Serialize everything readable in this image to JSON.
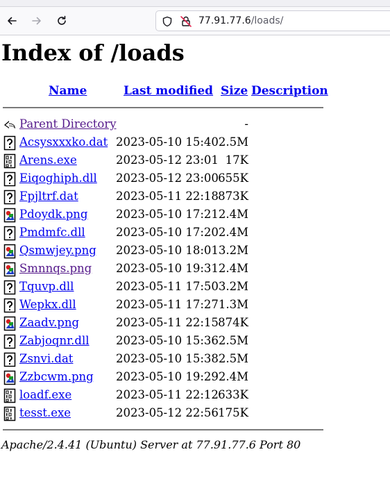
{
  "browser": {
    "url_host": "77.91.77.6",
    "url_path": "/loads/"
  },
  "page": {
    "title": "Index of /loads",
    "columns": {
      "name": "Name",
      "last_modified": "Last modified",
      "size": "Size",
      "description": "Description"
    },
    "parent": {
      "label": "Parent Directory",
      "size": "-"
    },
    "files": [
      {
        "name": "Acsysxxxko.dat",
        "date": "2023-05-10 15:40",
        "size": "2.5M",
        "icon": "unknown-file-icon"
      },
      {
        "name": "Arens.exe",
        "date": "2023-05-12 23:01",
        "size": "17K",
        "icon": "binary-file-icon"
      },
      {
        "name": "Eiqoghiph.dll",
        "date": "2023-05-12 23:00",
        "size": "655K",
        "icon": "unknown-file-icon"
      },
      {
        "name": "Fpjltrf.dat",
        "date": "2023-05-11 22:18",
        "size": "873K",
        "icon": "unknown-file-icon"
      },
      {
        "name": "Pdoydk.png",
        "date": "2023-05-10 17:21",
        "size": "2.4M",
        "icon": "image-file-icon"
      },
      {
        "name": "Pmdmfc.dll",
        "date": "2023-05-10 17:20",
        "size": "2.4M",
        "icon": "unknown-file-icon"
      },
      {
        "name": "Qsmwjey.png",
        "date": "2023-05-10 18:01",
        "size": "3.2M",
        "icon": "image-file-icon"
      },
      {
        "name": "Smnnqs.png",
        "date": "2023-05-10 19:31",
        "size": "2.4M",
        "icon": "image-file-icon"
      },
      {
        "name": "Tquvp.dll",
        "date": "2023-05-11 17:50",
        "size": "3.2M",
        "icon": "unknown-file-icon"
      },
      {
        "name": "Wepkx.dll",
        "date": "2023-05-11 17:27",
        "size": "1.3M",
        "icon": "unknown-file-icon"
      },
      {
        "name": "Zaadv.png",
        "date": "2023-05-11 22:15",
        "size": "874K",
        "icon": "image-file-icon"
      },
      {
        "name": "Zabjoqnr.dll",
        "date": "2023-05-10 15:36",
        "size": "2.5M",
        "icon": "unknown-file-icon"
      },
      {
        "name": "Zsnvi.dat",
        "date": "2023-05-10 15:38",
        "size": "2.5M",
        "icon": "unknown-file-icon"
      },
      {
        "name": "Zzbcwm.png",
        "date": "2023-05-10 19:29",
        "size": "2.4M",
        "icon": "image-file-icon"
      },
      {
        "name": "loadf.exe",
        "date": "2023-05-11 22:12",
        "size": "633K",
        "icon": "binary-file-icon"
      },
      {
        "name": "tesst.exe",
        "date": "2023-05-12 22:56",
        "size": "175K",
        "icon": "binary-file-icon"
      }
    ],
    "footer": "Apache/2.4.41 (Ubuntu) Server at 77.91.77.6 Port 80"
  },
  "colors": {
    "link": "#0000ee",
    "visited_link": "#551a8b",
    "rule": "#7a7a7a"
  }
}
